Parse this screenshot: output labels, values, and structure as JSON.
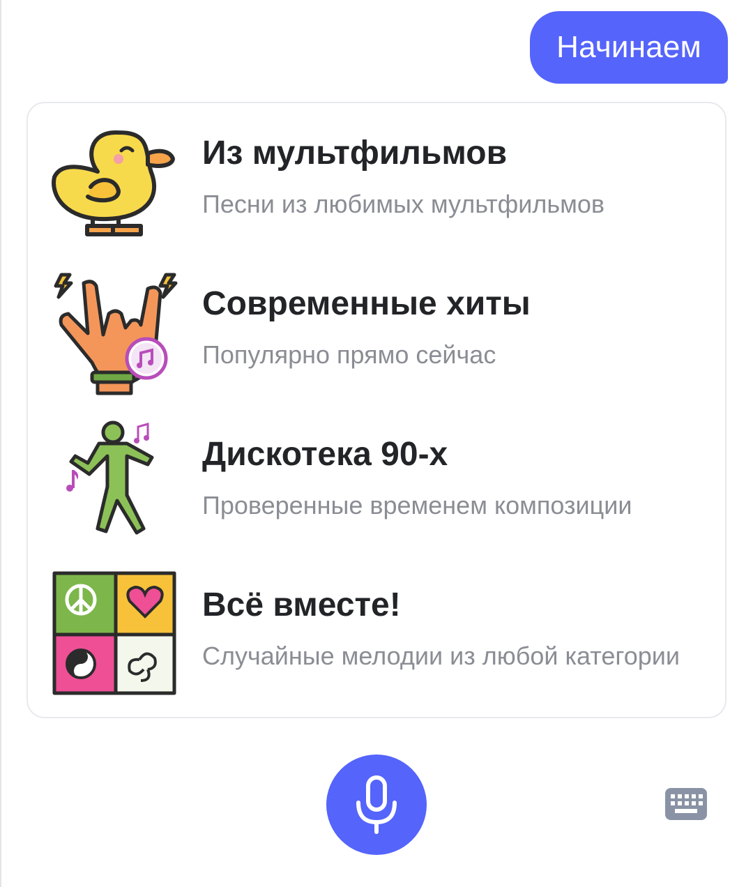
{
  "chat": {
    "user_message": "Начинаем"
  },
  "options": [
    {
      "title": "Из мультфильмов",
      "subtitle": "Песни из любимых мультфильмов",
      "icon": "duck-icon"
    },
    {
      "title": "Современные хиты",
      "subtitle": "Популярно прямо сейчас",
      "icon": "rock-hand-icon"
    },
    {
      "title": "Дискотека 90-х",
      "subtitle": "Проверенные временем композиции",
      "icon": "dancer-icon"
    },
    {
      "title": "Всё вместе!",
      "subtitle": "Случайные мелодии из любой категории",
      "icon": "puzzle-icon"
    }
  ],
  "input": {
    "mic_icon": "microphone-icon",
    "keyboard_icon": "keyboard-icon"
  },
  "colors": {
    "accent": "#5564fb",
    "title": "#232428",
    "subtitle": "#8b8d94",
    "card_border": "#e8e9ee",
    "keyboard": "#8a93a5"
  }
}
